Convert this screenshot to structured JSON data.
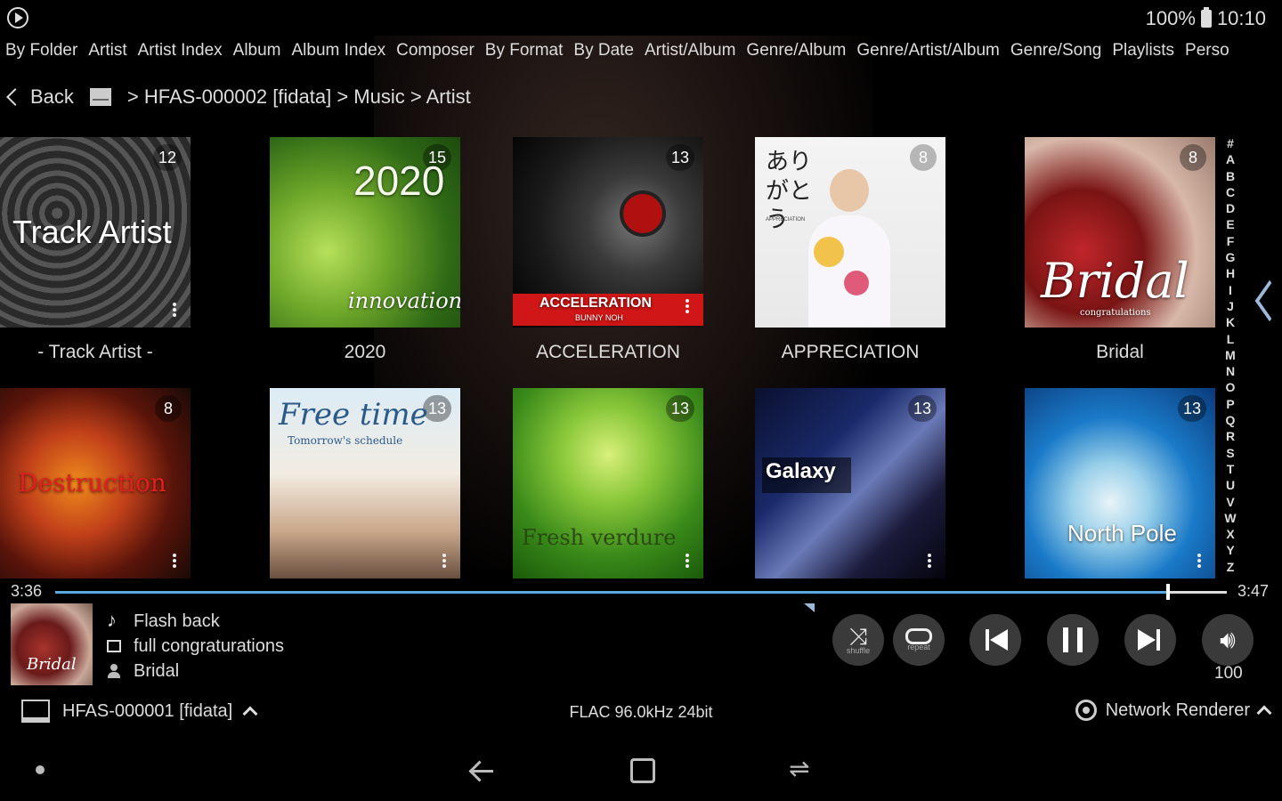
{
  "status": {
    "battery": "100%",
    "time": "10:10"
  },
  "menu": [
    "By Folder",
    "Artist",
    "Artist Index",
    "Album",
    "Album Index",
    "Composer",
    "By Format",
    "By Date",
    "Artist/Album",
    "Genre/Album",
    "Genre/Artist/Album",
    "Genre/Song",
    "Playlists",
    "Perso"
  ],
  "breadcrumb": {
    "back": "Back",
    "path": "> HFAS-000002 [fidata] > Music > Artist"
  },
  "albums": [
    {
      "title": "- Track Artist -",
      "count": "12",
      "cover_text": "Track Artist"
    },
    {
      "title": "2020",
      "count": "15",
      "cover_text": "2020",
      "cover_sub": "innovation"
    },
    {
      "title": "ACCELERATION",
      "count": "13",
      "cover_text": "ACCELERATION",
      "cover_sub": "BUNNY NOH"
    },
    {
      "title": "APPRECIATION",
      "count": "8",
      "cover_text": "ありがとう",
      "cover_sub": "APPRECIATION"
    },
    {
      "title": "Bridal",
      "count": "8",
      "cover_text": "Bridal",
      "cover_sub": "congratulations"
    },
    {
      "title": "",
      "count": "8",
      "cover_text": "Destruction"
    },
    {
      "title": "",
      "count": "13",
      "cover_text": "Free time",
      "cover_sub": "Tomorrow's schedule"
    },
    {
      "title": "",
      "count": "13",
      "cover_text": "Fresh verdure"
    },
    {
      "title": "",
      "count": "13",
      "cover_text": "Galaxy"
    },
    {
      "title": "",
      "count": "13",
      "cover_text": "North Pole"
    }
  ],
  "alphabet": [
    "#",
    "A",
    "B",
    "C",
    "D",
    "E",
    "F",
    "G",
    "H",
    "I",
    "J",
    "K",
    "L",
    "M",
    "N",
    "O",
    "P",
    "Q",
    "R",
    "S",
    "T",
    "U",
    "V",
    "W",
    "X",
    "Y",
    "Z"
  ],
  "player": {
    "elapsed": "3:36",
    "total": "3:47",
    "progress": 0.95,
    "track": "Flash back",
    "album": "full congraturations",
    "artist": "Bridal",
    "art_text": "Bridal",
    "shuffle_label": "shuffle",
    "repeat_label": "repeat",
    "volume": "100"
  },
  "footer": {
    "server": "HFAS-000001 [fidata]",
    "format": "FLAC 96.0kHz 24bit",
    "renderer": "Network Renderer"
  },
  "colors": {
    "accent": "#5aa8e0",
    "background": "#000000"
  }
}
